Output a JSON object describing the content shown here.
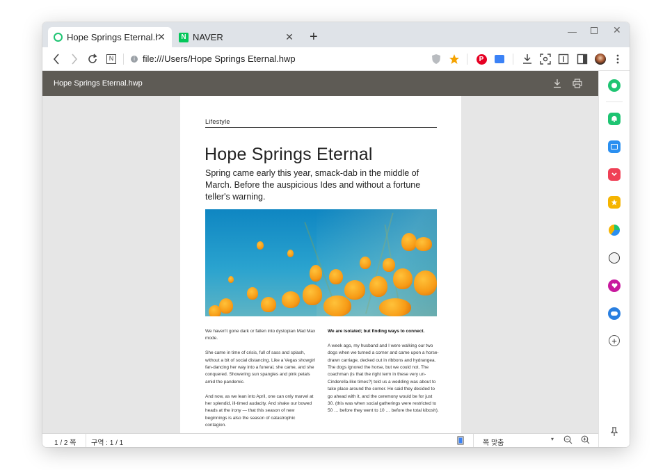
{
  "tabs": [
    {
      "title": "Hope Springs Eternal.hwp",
      "active": true,
      "icon": "whale-ring-icon"
    },
    {
      "title": "NAVER",
      "active": false,
      "icon": "naver-icon",
      "icon_letter": "N"
    }
  ],
  "toolbar": {
    "url": "file:///Users/Hope Springs Eternal.hwp",
    "naver_letter": "N"
  },
  "viewer": {
    "title": "Hope Springs Eternal.hwp"
  },
  "article": {
    "category": "Lifestyle",
    "headline": "Hope Springs Eternal",
    "dek": "Spring came early this year, smack-dab in the middle of March. Before the auspicious Ides and without a fortune teller's warning.",
    "left_col": [
      "We haven't gone dark or fallen into dystopian Mad Max mode.",
      "She came in time of crisis, full of sass and splash, without a bit of social distancing. Like a Vegas showgirl fan-dancing her way into a funeral, she came, and she conquered. Showering sun spangles and pink petals amid the pandemic.",
      "And now, as we lean into April, one can only marvel at her splendid, ill-timed audacity. And shake our bowed heads at the irony — that this season of new beginnings is also the season of catastrophic contagion."
    ],
    "right_col_lead": "We are isolated; but finding ways to connect.",
    "right_col": [
      "A week ago, my husband and I were walking our two dogs when we turned a corner and came upon a horse-drawn carriage, decked out in ribbons and hydrangea. The dogs ignored the horse, but we could not. The coachman (is that the right term in these very un-Cinderella-like times?) told us a wedding was about to take place around the corner. He said they decided to go ahead with it, and the ceremony would be for just 30. (this was when social gatherings were restricted to 50 … before they went to 10 … before the total kibosh)."
    ]
  },
  "status": {
    "page": "1 / 2 쪽",
    "section": "구역 : 1 / 1",
    "zoom": "쪽 맞춤"
  },
  "colors": {
    "accent_green": "#1ec472",
    "viewer_header": "#5e5b55"
  }
}
